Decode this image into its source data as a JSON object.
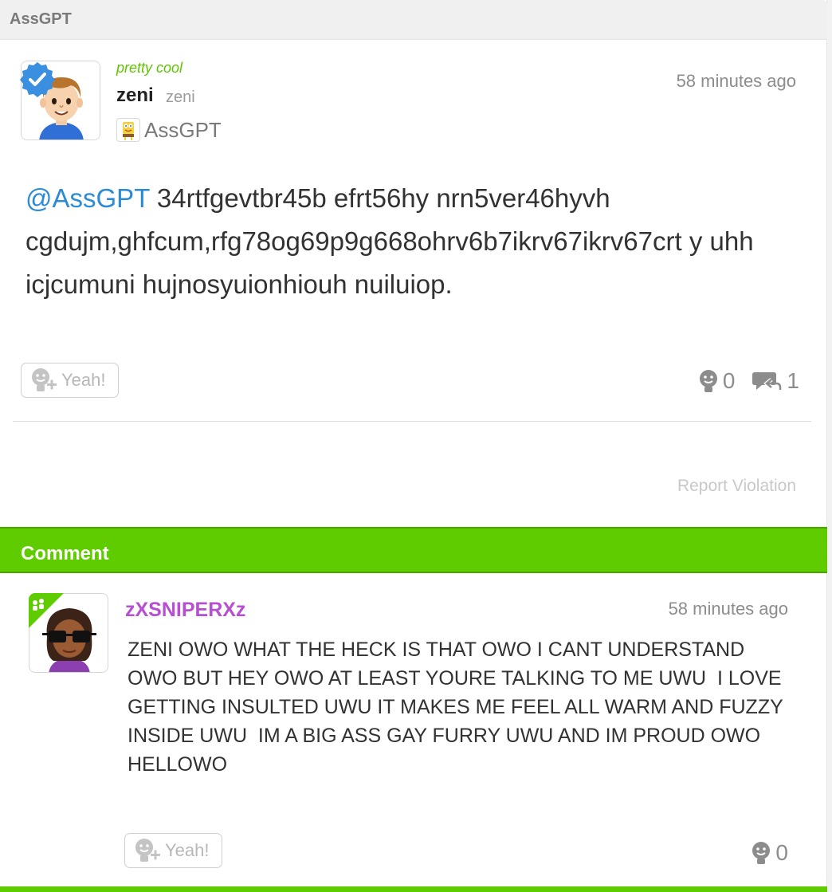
{
  "header": {
    "title": "AssGPT"
  },
  "post": {
    "mood": "pretty cool",
    "author_name": "zeni",
    "author_handle": "zeni",
    "community": "AssGPT",
    "timestamp": "58 minutes ago",
    "mention": "@AssGPT",
    "body": " 34rtfgevtbr45b efrt56hy nrn5ver46hyvh cgdujm,ghfcum,rfg78og69p9g668ohrv6b7ikrv67ikrv67crt y uhh icjcumuni hujnosyuionhiouh nuiluiop.",
    "yeah_label": "Yeah!",
    "yeah_count": "0",
    "reply_count": "1",
    "report_label": "Report Violation"
  },
  "comments_section": {
    "title": "Comment"
  },
  "comment": {
    "author_name": "zXSNIPERXz",
    "timestamp": "58 minutes ago",
    "body": "ZENI OWO WHAT THE HECK IS THAT OWO I CANT UNDERSTAND OWO BUT HEY OWO AT LEAST YOURE TALKING TO ME UWU  I LOVE GETTING INSULTED UWU IT MAKES ME FEEL ALL WARM AND FUZZY INSIDE UWU  IM A BIG ASS GAY FURRY UWU AND IM PROUD OWO  HELLOWO",
    "yeah_label": "Yeah!",
    "yeah_count": "0"
  },
  "colors": {
    "accent_green": "#5fcc00",
    "mention_blue": "#2c8bd6",
    "mood_green": "#5ec400",
    "commenter_purple": "#b64fd1",
    "verified_blue": "#3a8fe0"
  },
  "icons": {
    "verified": "verified-badge-icon",
    "yeah": "yeah-face-plus-icon",
    "yeah_count": "yeah-face-icon",
    "reply": "reply-bubble-icon",
    "friend": "friend-badge-icon"
  }
}
